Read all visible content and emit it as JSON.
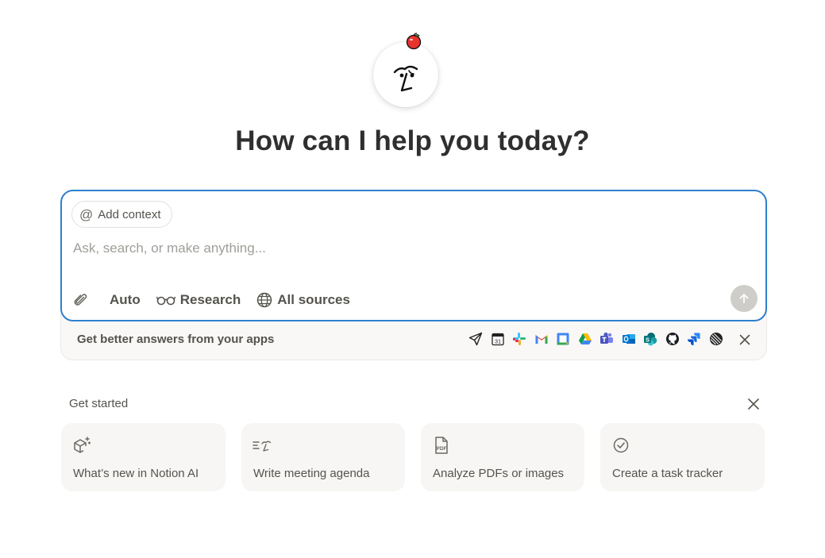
{
  "headline": "How can I help you today?",
  "composer": {
    "add_context_label": "Add context",
    "input_placeholder": "Ask, search, or make anything...",
    "input_value": "",
    "mode_label": "Auto",
    "research_label": "Research",
    "sources_label": "All sources",
    "border_color": "#2f7fcf"
  },
  "apps": {
    "prompt": "Get better answers from your apps",
    "icons": [
      "send-icon",
      "calendar-icon",
      "slack-icon",
      "gmail-icon",
      "google-calendar-icon",
      "google-drive-icon",
      "teams-icon",
      "outlook-icon",
      "sharepoint-icon",
      "github-icon",
      "jira-icon",
      "linear-icon"
    ]
  },
  "get_started": {
    "label": "Get started",
    "cards": [
      {
        "label": "What’s new in Notion AI",
        "icon": "box-sparkle-icon"
      },
      {
        "label": "Write meeting agenda",
        "icon": "agenda-icon"
      },
      {
        "label": "Analyze PDFs or images",
        "icon": "pdf-icon"
      },
      {
        "label": "Create a task tracker",
        "icon": "check-circle-icon"
      }
    ]
  },
  "calendar_icon_text": "31"
}
